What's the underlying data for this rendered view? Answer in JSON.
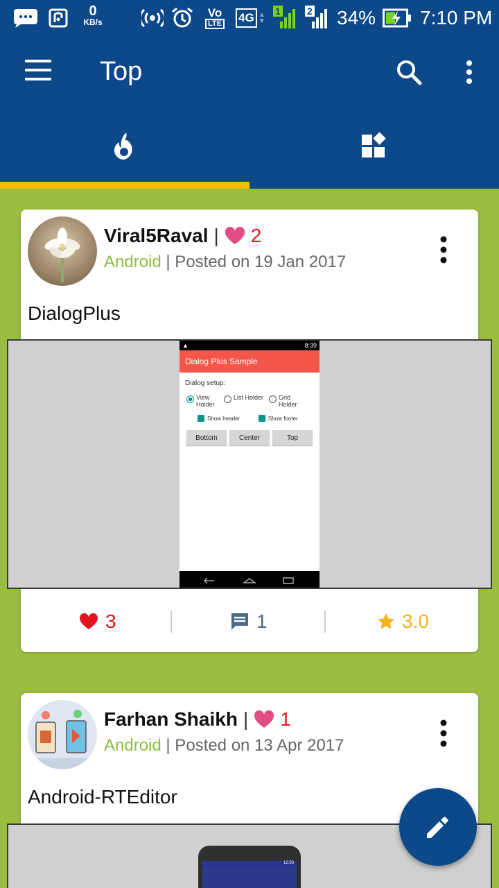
{
  "status_bar": {
    "speed_value": "0",
    "speed_unit": "KB/s",
    "network": "4G",
    "sim1": "1",
    "sim2": "2",
    "volte_top": "Vo",
    "volte_bottom": "LTE",
    "battery": "34%",
    "time": "7:10 PM",
    "icons": [
      "chat-icon",
      "nfc-icon",
      "hotspot-icon",
      "alarm-icon",
      "volte-icon",
      "signal-icon",
      "battery-charging-icon"
    ]
  },
  "app_bar": {
    "title": "Top",
    "icons": [
      "menu-icon",
      "search-icon",
      "more-vert-icon"
    ]
  },
  "tabs": [
    {
      "icon": "flame-icon",
      "selected": true
    },
    {
      "icon": "categories-icon",
      "selected": false
    }
  ],
  "colors": {
    "primary": "#0d4889",
    "background": "#9bbd3f",
    "tab_indicator": "#f7bd00",
    "like_red": "#e6121d",
    "heart_pink": "#e14d85",
    "category_green": "#8cbf3f",
    "rating_gold": "#f5b21b"
  },
  "posts": [
    {
      "author": "Viral5Raval",
      "separator": "|",
      "author_likes": "2",
      "category": "Android",
      "posted": "| Posted on 19 Jan 2017",
      "title": "DialogPlus",
      "screenshot": {
        "time": "8:39",
        "toolbar": "Dialog Plus Sample",
        "label": "Dialog setup:",
        "radio_options": [
          {
            "label": "View Holder",
            "selected": true
          },
          {
            "label": "List Holder",
            "selected": false
          },
          {
            "label": "Grid Holder",
            "selected": false
          }
        ],
        "checkboxes": [
          "Show header",
          "Show footer"
        ],
        "buttons": [
          "Bottom",
          "Center",
          "Top"
        ]
      },
      "likes": "3",
      "comments": "1",
      "rating": "3.0"
    },
    {
      "author": "Farhan Shaikh",
      "separator": "|",
      "author_likes": "1",
      "category": "Android",
      "posted": "| Posted on 13 Apr 2017",
      "title": "Android-RTEditor",
      "screenshot": {
        "time": "12:53"
      }
    }
  ],
  "fab": {
    "icon": "edit-pencil-icon"
  }
}
